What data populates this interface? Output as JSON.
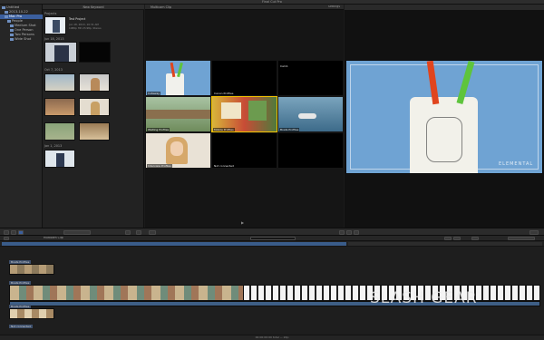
{
  "window": {
    "title": "Final Cut Pro"
  },
  "library": {
    "items": [
      {
        "label": "Untitled",
        "selected": false
      },
      {
        "label": "2013-10-22",
        "selected": false
      },
      {
        "label": "Mac Pro",
        "selected": true
      },
      {
        "label": "People",
        "selected": false
      },
      {
        "label": "Medium Shot",
        "selected": false
      },
      {
        "label": "One Person",
        "selected": false
      },
      {
        "label": "Two Persons",
        "selected": false
      },
      {
        "label": "Wide Shot",
        "selected": false
      }
    ]
  },
  "browser": {
    "header": "New Keyword",
    "sections": [
      {
        "label": "Projects"
      },
      {
        "label": "Jun 18, 2013"
      },
      {
        "label": "Oct 7, 2013"
      },
      {
        "label": "Jan 1, 2013"
      }
    ],
    "project": {
      "name": "Test Project",
      "date": "Jun 18, 2013, 10:31 AM",
      "format": "1080p HD 23.98p, Stereo"
    }
  },
  "angle_viewer": {
    "header": "Multicam Clip",
    "settings": "Settings",
    "angles": [
      "Cutaway",
      "Canon Profiles",
      "Cam1",
      "Waiting Profiles",
      "Mobile Profiles",
      "Boats Profiles",
      "Interview Profiles",
      "Not connected",
      ""
    ]
  },
  "viewer": {
    "overlay_text": "ELEMENTAL"
  },
  "timeline": {
    "header": "Multicam Clip",
    "tracks": [
      {
        "label": "Boats Profiles"
      },
      {
        "label": "Boats Profiles"
      },
      {
        "label": "Boats Profiles"
      },
      {
        "label": "Not connected"
      }
    ]
  },
  "status": {
    "text": "00:00:00:00 total — 24p"
  },
  "watermark": {
    "text": "SLASH GEAR"
  },
  "colors": {
    "accent": "#3b5f9e",
    "angle_highlight": "#f0c000",
    "sky": "#6fa3d3"
  }
}
